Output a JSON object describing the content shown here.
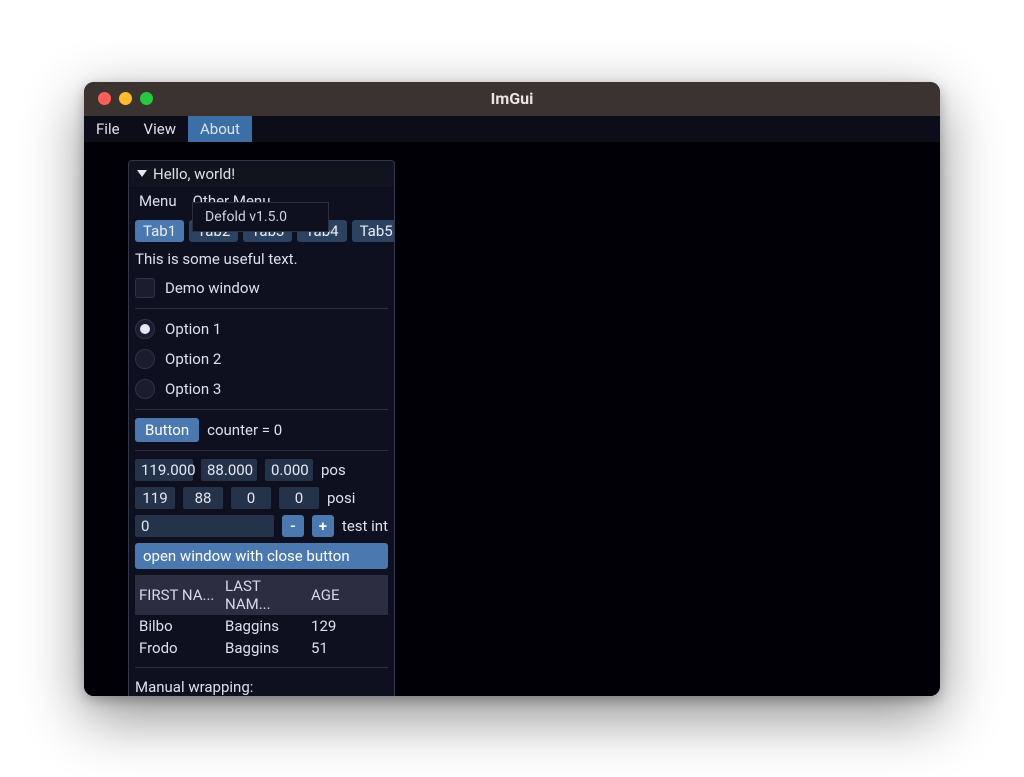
{
  "window": {
    "title": "ImGui"
  },
  "menubar": {
    "items": [
      "File",
      "View",
      "About"
    ],
    "active_index": 2,
    "dropdown_label": "Defold v1.5.0"
  },
  "panel": {
    "title": "Hello, world!",
    "menu": {
      "items": [
        "Menu",
        "Other Menu"
      ]
    },
    "tabs": [
      "Tab1",
      "Tab2",
      "Tab3",
      "Tab4",
      "Tab5"
    ],
    "active_tab": 0,
    "useful_text": "This is some useful text.",
    "checkbox_label": "Demo window",
    "radios": [
      "Option 1",
      "Option 2",
      "Option 3"
    ],
    "radio_selected": 0,
    "button_label": "Button",
    "counter_label": "counter = 0",
    "pos_floats": [
      "119.000",
      "88.000",
      "0.000"
    ],
    "pos_label": "pos",
    "pos_ints": [
      "119",
      "88",
      "0",
      "0"
    ],
    "posi_label": "posi",
    "test_int_value": "0",
    "test_int_label": "test int",
    "minus": "-",
    "plus": "+",
    "open_window_label": "open window with close button",
    "table": {
      "headers": [
        "FIRST NA...",
        "LAST NAM...",
        "AGE"
      ],
      "rows": [
        [
          "Bilbo",
          "Baggins",
          "129"
        ],
        [
          "Frodo",
          "Baggins",
          "51"
        ]
      ]
    },
    "wrap_label": "Manual wrapping:"
  }
}
